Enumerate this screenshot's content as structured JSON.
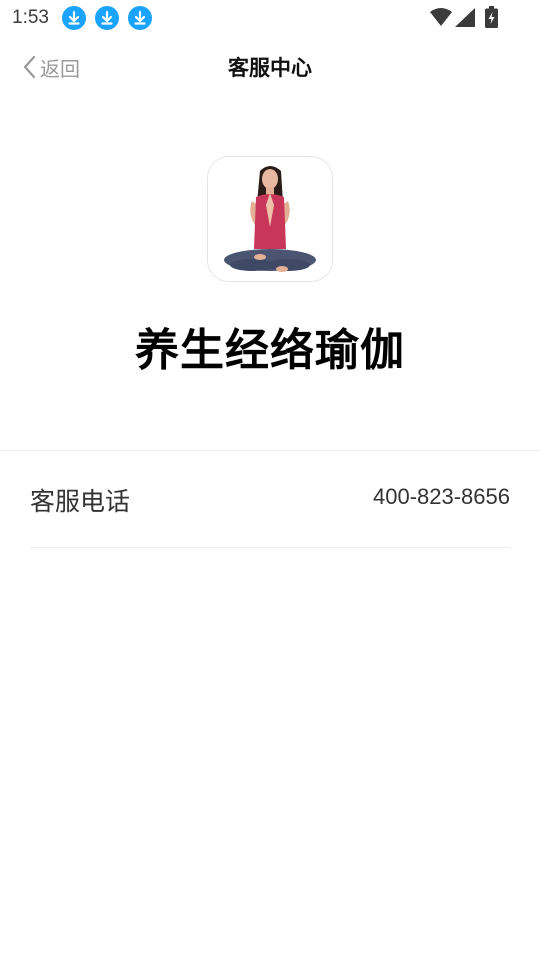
{
  "status_bar": {
    "time": "1:53",
    "notification_icons": [
      "download-icon",
      "download-icon",
      "download-icon"
    ],
    "right_icons": [
      "wifi-icon",
      "cellular-signal-icon",
      "battery-charging-icon"
    ],
    "accent": "#1aa3ff"
  },
  "navbar": {
    "back_label": "返回",
    "title": "客服中心"
  },
  "app": {
    "logo_icon": "yoga-woman-lotus-pose-logo",
    "name": "养生经络瑜伽"
  },
  "contact": {
    "label": "客服电话",
    "value": "400-823-8656"
  }
}
